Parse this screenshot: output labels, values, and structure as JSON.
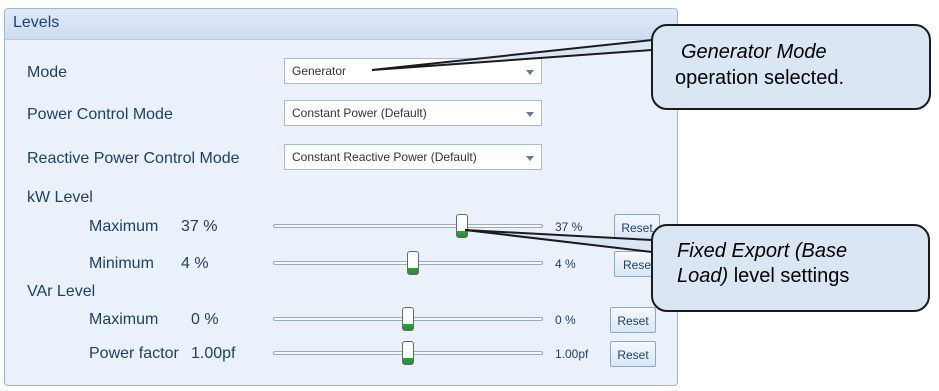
{
  "panel": {
    "title": "Levels"
  },
  "mode": {
    "label": "Mode",
    "value": "Generator"
  },
  "power_control_mode": {
    "label": "Power Control Mode",
    "value": "Constant Power (Default)"
  },
  "reactive_power_control_mode": {
    "label": "Reactive Power Control Mode",
    "value": "Constant Reactive Power (Default)"
  },
  "kw_level": {
    "heading": "kW Level",
    "maximum": {
      "label": "Maximum",
      "value_text": "37 %",
      "slider_text": "37 %",
      "fraction": 0.7,
      "reset_label": "Reset"
    },
    "minimum": {
      "label": "Minimum",
      "value_text": "4 %",
      "slider_text": "4 %",
      "fraction": 0.52,
      "reset_label": "Rese"
    }
  },
  "var_level": {
    "heading": "VAr Level",
    "maximum": {
      "label": "Maximum",
      "value_text": "0 %",
      "slider_text": "0 %",
      "fraction": 0.5,
      "reset_label": "Reset"
    },
    "power_factor": {
      "label": "Power factor",
      "value_text": "1.00pf",
      "slider_text": "1.00pf",
      "fraction": 0.5,
      "reset_label": "Reset"
    }
  },
  "callouts": {
    "generator": {
      "emphasis": "Generator Mode",
      "rest": "operation selected."
    },
    "fixed_export": {
      "emphasis_1": "Fixed Export (Base",
      "emphasis_2": "Load)",
      "rest": " level settings"
    }
  },
  "colors": {
    "panel_bg": "#eaf1fb",
    "text": "#1e3f6b",
    "callout_bg": "#dae6f3",
    "thumb_green": "#33a23a"
  }
}
